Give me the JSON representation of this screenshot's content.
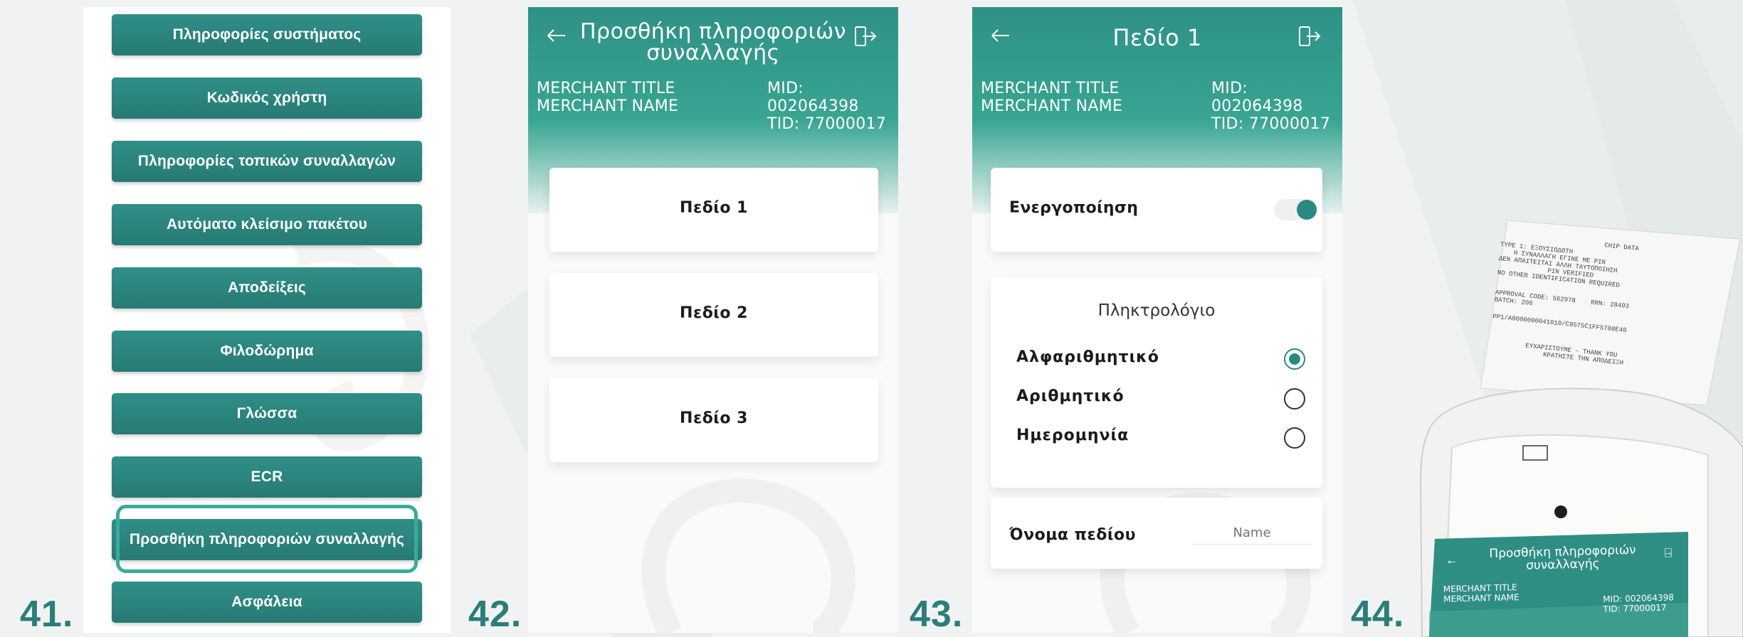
{
  "steps": [
    "41.",
    "42.",
    "43.",
    "44."
  ],
  "colors": {
    "accent": "#2a8a83",
    "header_top": "#2e9186",
    "highlight": "#3aaa9d",
    "step_number": "#2a7d7a"
  },
  "screen41": {
    "menu_items": [
      "Πληροφορίες συστήματος",
      "Κωδικός χρήστη",
      "Πληροφορίες τοπικών συναλλαγών",
      "Αυτόματο κλείσιμο πακέτου",
      "Αποδείξεις",
      "Φιλοδώρημα",
      "Γλώσσα",
      "ECR",
      "Προσθήκη πληροφοριών συναλλαγής",
      "Ασφάλεια"
    ],
    "selected_item": "Προσθήκη πληροφοριών συναλλαγής"
  },
  "screen42": {
    "back_icon": "back-arrow-icon",
    "exit_icon": "logout-icon",
    "title_line1": "Προσθήκη πληροφοριών",
    "title_line2": "συναλλαγής",
    "merchant_title": "MERCHANT TITLE",
    "merchant_name": "MERCHANT NAME",
    "mid": "MID: 002064398",
    "tid": "TID: 77000017",
    "fields": [
      "Πεδίο 1",
      "Πεδίο 2",
      "Πεδίο 3"
    ]
  },
  "screen43": {
    "back_icon": "back-arrow-icon",
    "exit_icon": "logout-icon",
    "title": "Πεδίο 1",
    "merchant_title": "MERCHANT TITLE",
    "merchant_name": "MERCHANT NAME",
    "mid": "MID: 002064398",
    "tid": "TID: 77000017",
    "enable_label": "Ενεργοποίηση",
    "enable_on": true,
    "keyboard_title": "Πληκτρολόγιο",
    "keyboard_options": [
      "Αλφαριθμητικό",
      "Αριθμητικό",
      "Ημερομηνία"
    ],
    "keyboard_selected": "Αλφαριθμητικό",
    "field_name_label": "Όνομα πεδίου",
    "field_name_placeholder": "Name"
  },
  "screen44": {
    "receipt_lines": [
      "CHIP DATA",
      "TYPE 1: ΕΞΟΥΣΙΟΔΟΤΗ",
      "Η ΣΥΝΑΛΛΑΓΗ ΕΓΙΝΕ ΜΕ PIN",
      "ΔΕΝ ΑΠΑΙΤΕΙΤΑΙ ΑΛΛΗ ΤΑΥΤΟΠΟΙΗΣΗ",
      "PIN VERIFIED",
      "NO OTHER IDENTIFICATION REQUIRED",
      "APPROVAL CODE: 562978",
      "RRN: 28493",
      "BATCH: 206",
      "PP1/A0000000041010/C9575C1FF5788E40",
      "ΕΥΧΑΡΙΣΤΟΥΜΕ - THANK YOU",
      "ΚΡΑΤΗΣΤΕ ΤΗΝ ΑΠΟΔΕΙΞΗ"
    ],
    "title_line1": "Προσθήκη πληροφοριών",
    "title_line2": "συναλλαγής",
    "merchant_title": "MERCHANT TITLE",
    "merchant_name": "MERCHANT NAME",
    "mid": "MID: 002064398",
    "tid": "TID: 77000017"
  }
}
